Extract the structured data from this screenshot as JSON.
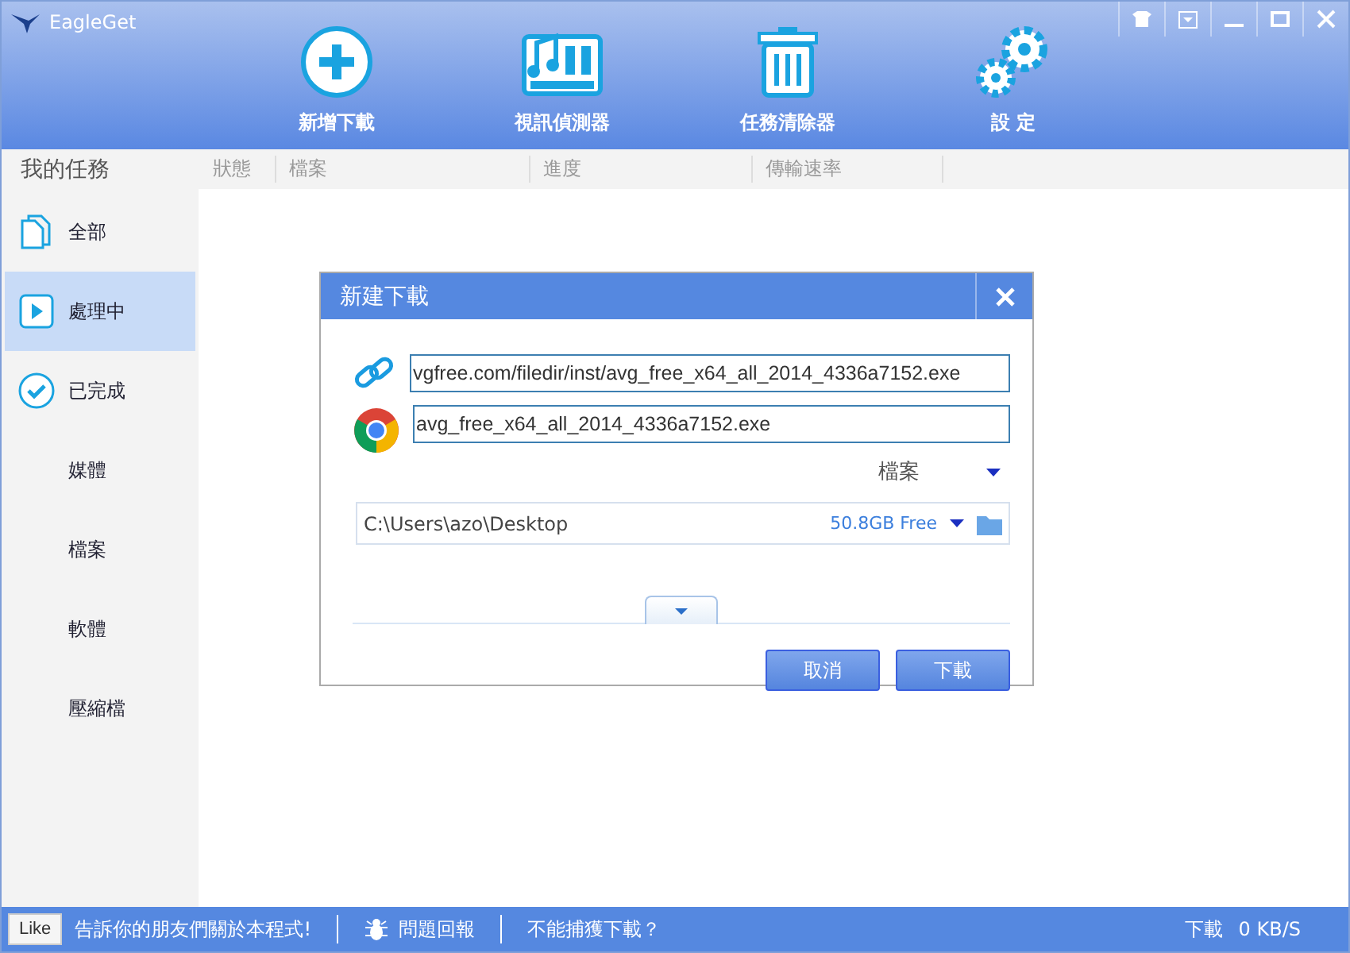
{
  "window": {
    "title": "EagleGet"
  },
  "toolbar": [
    {
      "label": "新增下載",
      "kind": "add"
    },
    {
      "label": "視訊偵測器",
      "kind": "media"
    },
    {
      "label": "任務清除器",
      "kind": "trash"
    },
    {
      "label": "設 定",
      "kind": "settings"
    }
  ],
  "sidebar": {
    "title": "我的任務",
    "items": [
      {
        "label": "全部",
        "kind": "all",
        "selected": false
      },
      {
        "label": "處理中",
        "kind": "active",
        "selected": true
      },
      {
        "label": "已完成",
        "kind": "done",
        "selected": false
      },
      {
        "label": "媒體",
        "kind": "plain",
        "selected": false
      },
      {
        "label": "檔案",
        "kind": "plain",
        "selected": false
      },
      {
        "label": "軟體",
        "kind": "plain",
        "selected": false
      },
      {
        "label": "壓縮檔",
        "kind": "plain",
        "selected": false
      }
    ]
  },
  "table": {
    "columns": [
      "狀態",
      "檔案",
      "進度",
      "傳輸速率"
    ]
  },
  "dialog": {
    "title": "新建下載",
    "url": "vgfree.com/filedir/inst/avg_free_x64_all_2014_4336a7152.exe",
    "filename": "avg_free_x64_all_2014_4336a7152.exe",
    "category": "檔案",
    "path": "C:\\Users\\azo\\Desktop",
    "free_space": "50.8GB Free",
    "buttons": [
      "取消",
      "下載"
    ]
  },
  "status_bar": {
    "like": "Like",
    "share": "告訴你的朋友們關於本程式!",
    "report": "問題回報",
    "help": "不能捕獲下載？",
    "speed_label": "下載",
    "speed": "0 KB/S"
  }
}
